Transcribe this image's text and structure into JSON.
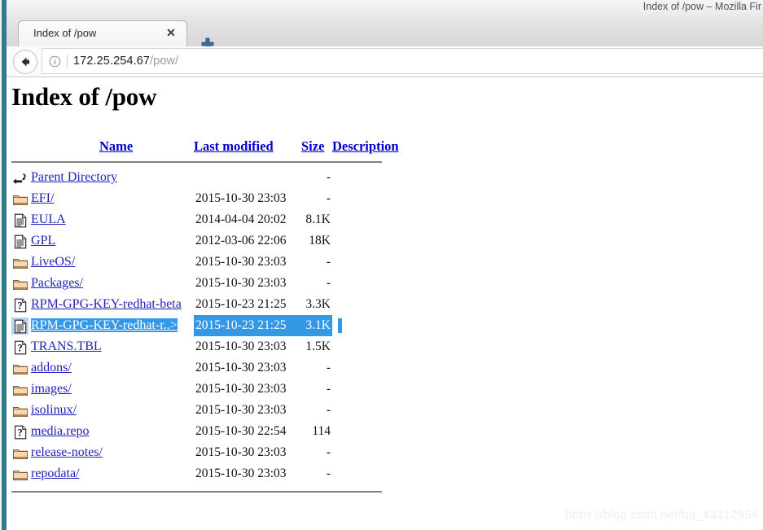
{
  "window": {
    "title": "Index of /pow – Mozilla Fir"
  },
  "tabs": [
    {
      "label": "Index of /pow",
      "close_icon": "close-icon",
      "active": true
    }
  ],
  "newtab": {
    "icon": "plus-icon",
    "label": "+"
  },
  "toolbar": {
    "back": {
      "icon": "back-arrow-icon"
    },
    "url": {
      "info_icon": "info-circle-icon",
      "host": "172.25.254.67",
      "path": "/pow/",
      "full": "172.25.254.67/pow/"
    }
  },
  "page": {
    "title": "Index of /pow",
    "headers": {
      "name": "Name",
      "last_modified": "Last modified",
      "size": "Size",
      "description": "Description"
    },
    "parent": {
      "icon": "parent-directory-icon",
      "name": "Parent Directory",
      "last_modified": "",
      "size": "-",
      "description": ""
    },
    "rows": [
      {
        "icon": "folder-icon",
        "name": "EFI/",
        "last_modified": "2015-10-30 23:03",
        "size": "-",
        "description": "",
        "selected": false
      },
      {
        "icon": "document-icon",
        "name": "EULA",
        "last_modified": "2014-04-04 20:02",
        "size": "8.1K",
        "description": "",
        "selected": false
      },
      {
        "icon": "document-icon",
        "name": "GPL",
        "last_modified": "2012-03-06 22:06",
        "size": "18K",
        "description": "",
        "selected": false
      },
      {
        "icon": "folder-icon",
        "name": "LiveOS/",
        "last_modified": "2015-10-30 23:03",
        "size": "-",
        "description": "",
        "selected": false
      },
      {
        "icon": "folder-icon",
        "name": "Packages/",
        "last_modified": "2015-10-30 23:03",
        "size": "-",
        "description": "",
        "selected": false
      },
      {
        "icon": "unknown-icon",
        "name": "RPM-GPG-KEY-redhat-beta",
        "last_modified": "2015-10-23 21:25",
        "size": "3.3K",
        "description": "",
        "selected": false
      },
      {
        "icon": "document-icon",
        "name": "RPM-GPG-KEY-redhat-r..>",
        "last_modified": "2015-10-23 21:25",
        "size": "3.1K",
        "description": "",
        "selected": true
      },
      {
        "icon": "unknown-icon",
        "name": "TRANS.TBL",
        "last_modified": "2015-10-30 23:03",
        "size": "1.5K",
        "description": "",
        "selected": false
      },
      {
        "icon": "folder-icon",
        "name": "addons/",
        "last_modified": "2015-10-30 23:03",
        "size": "-",
        "description": "",
        "selected": false
      },
      {
        "icon": "folder-icon",
        "name": "images/",
        "last_modified": "2015-10-30 23:03",
        "size": "-",
        "description": "",
        "selected": false
      },
      {
        "icon": "folder-icon",
        "name": "isolinux/",
        "last_modified": "2015-10-30 23:03",
        "size": "-",
        "description": "",
        "selected": false
      },
      {
        "icon": "unknown-icon",
        "name": "media.repo",
        "last_modified": "2015-10-30 22:54",
        "size": "114",
        "description": "",
        "selected": false
      },
      {
        "icon": "folder-icon",
        "name": "release-notes/",
        "last_modified": "2015-10-30 23:03",
        "size": "-",
        "description": "",
        "selected": false
      },
      {
        "icon": "folder-icon",
        "name": "repodata/",
        "last_modified": "2015-10-30 23:03",
        "size": "-",
        "description": "",
        "selected": false
      }
    ]
  },
  "watermark": "https://blog.csdn.net/qq_43312954",
  "colors": {
    "desktop_strip": "#2e7c8c",
    "link": "#2222bb",
    "header_link": "#0000cc",
    "selection": "#3399e6",
    "folder": "#f0c090",
    "rule": "#808080"
  }
}
